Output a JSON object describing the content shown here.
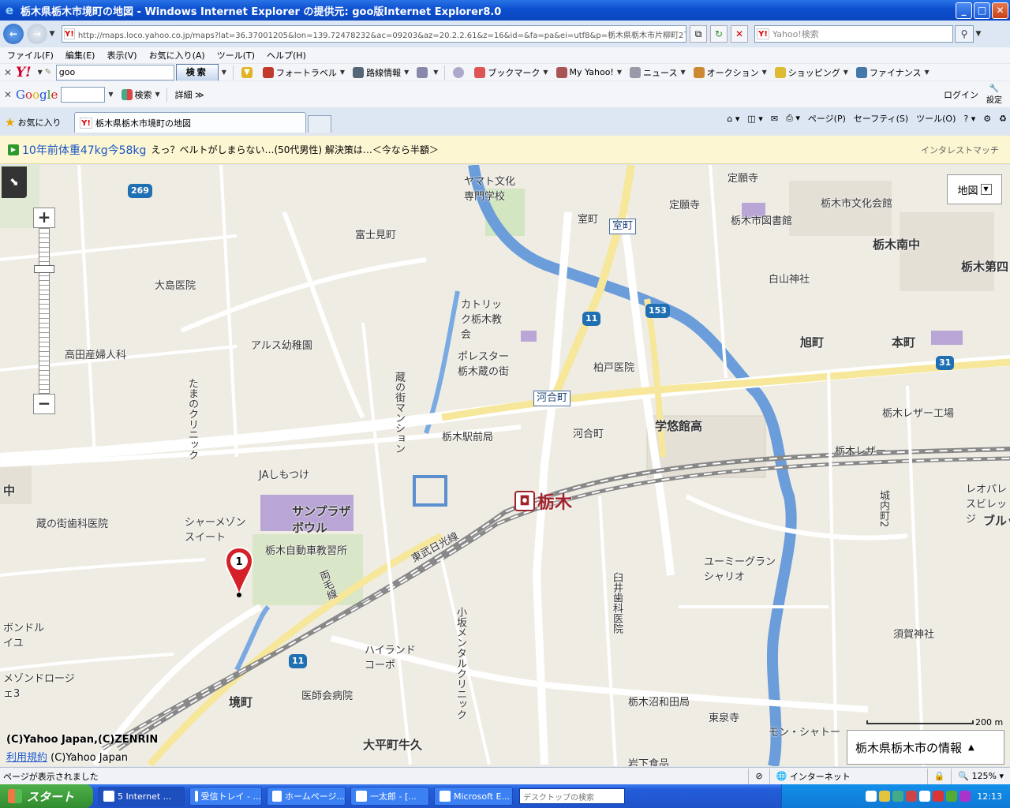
{
  "window": {
    "title": "栃木県栃木市境町の地図 - Windows Internet Explorer の提供元: goo版Internet Explorer8.0"
  },
  "address": {
    "url": "http://maps.loco.yahoo.co.jp/maps?lat=36.37001205&lon=139.72478232&ac=09203&az=20.2.2.61&z=16&id=&fa=pa&ei=utf8&p=栃木県栃木市片柳町2丁目2",
    "search_placeholder": "Yahoo!検索"
  },
  "menu": [
    "ファイル(F)",
    "編集(E)",
    "表示(V)",
    "お気に入り(A)",
    "ツール(T)",
    "ヘルプ(H)"
  ],
  "yahoo_toolbar": {
    "logo": "Y!",
    "query": "goo",
    "search_button": "検索",
    "items": [
      "フォートラベル",
      "路線情報",
      "ブックマーク",
      "My Yahoo!",
      "ニュース",
      "オークション",
      "ショッピング",
      "ファイナンス"
    ]
  },
  "google_toolbar": {
    "logo": "Google",
    "search_label": "検索",
    "more_label": "詳細 ≫",
    "login": "ログイン",
    "settings": "設定"
  },
  "tabs": {
    "favorites": "お気に入り",
    "active_tab": "栃木県栃木市境町の地図",
    "commands": [
      "ページ(P)",
      "セーフティ(S)",
      "ツール(O)"
    ]
  },
  "ad": {
    "link": "10年前体重47kg今58kg",
    "text": "えっ？ベルトがしまらない…(50代男性) 解決策は…＜今なら半額＞",
    "source": "インタレストマッチ"
  },
  "map": {
    "type_label": "地図",
    "station": "栃木",
    "pin_number": "1",
    "copyright": "(C)Yahoo Japan,(C)ZENRIN",
    "terms_link": "利用規約",
    "terms_rest": "(C)Yahoo Japan",
    "scale": "200 m",
    "info_label": "栃木県栃木市の情報",
    "labels": {
      "yamato": "ヤマト文化専門学校",
      "jouganji": "定願寺",
      "toshokan": "栃木市図書館",
      "bunka": "栃木市文化会館",
      "minamichu": "栃木南中",
      "daiyon": "栃木第四",
      "muromachi": "室町",
      "fujimi": "富士見町",
      "teiganji": "定願寺",
      "hakusan": "白山神社",
      "oshima": "大島医院",
      "catholic": "カトリック栃木教会",
      "arusu": "アルス幼稚園",
      "takada": "高田産婦人科",
      "polestar": "ポレスター栃木蔵の街",
      "kura_mansion": "蔵の街マンション",
      "tamano": "たまのクリニック",
      "kashiwado": "柏戸医院",
      "asahicho": "旭町",
      "honcho": "本町",
      "kawaimachi_box": "河合町",
      "kawaimachi": "河合町",
      "gakuyukan": "学悠館高",
      "leather_kojo": "栃木レザー工場",
      "leather": "栃木レザー",
      "ekimae_post": "栃木駅前局",
      "ja": "JAしもつけ",
      "sunplaza": "サンプラザボウル",
      "jidosha": "栃木自動車教習所",
      "sharmaison": "シャーメゾンスイート",
      "kura_shika": "蔵の街歯科医院",
      "tobu": "東武日光線",
      "ryomo": "両毛線",
      "leopalace": "レオパレスビレッジ",
      "shironouchi": "城内町2",
      "umi": "ユーミーグランシャリオ",
      "usui": "臼井歯科医院",
      "kosaka": "小坂メンタルクリニック",
      "highland": "ハイランドコーポ",
      "ishikai": "医師会病院",
      "sakaicho": "境町",
      "ohira": "大平町牛久",
      "numawada": "栃木沼和田局",
      "tosenji": "東泉寺",
      "monshato": "モン・シャトー",
      "susaki": "須賀神社",
      "bondo": "ボンドルイユ",
      "mesonde": "メゾンドロージェ3",
      "iwashita": "岩下食品",
      "naka": "中",
      "blue": "ブルッ"
    },
    "routes": {
      "r269": "269",
      "r11a": "11",
      "r153": "153",
      "r31": "31",
      "r11b": "11"
    }
  },
  "status": {
    "text": "ページが表示されました",
    "zone": "インターネット",
    "zoom": "125%"
  },
  "taskbar": {
    "start": "スタート",
    "tasks": [
      "5 Internet ...",
      "受信トレイ - ...",
      "ホームページ...",
      "一太郎 - [...",
      "Microsoft E..."
    ],
    "desktop_search": "デスクトップの検索",
    "clock": "12:13"
  }
}
